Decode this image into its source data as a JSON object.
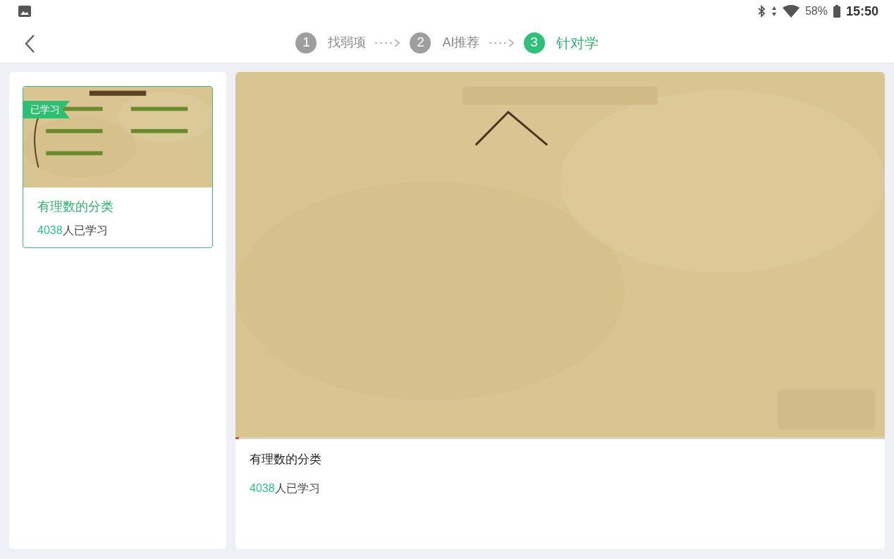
{
  "status_bar": {
    "battery": "58%",
    "time": "15:50"
  },
  "steps": [
    {
      "number": "1",
      "label": "找弱项",
      "selected": false
    },
    {
      "number": "2",
      "label": "AI推荐",
      "selected": false
    },
    {
      "number": "3",
      "label": "针对学",
      "selected": true
    }
  ],
  "lessons": [
    {
      "badge": "已学习",
      "title": "有理数的分类",
      "count": "4038",
      "count_suffix": "人已学习",
      "selected": true
    }
  ],
  "player": {
    "level": 0.005,
    "title": "有理数的分类",
    "count": "4038",
    "count_suffix": "人已学习"
  }
}
